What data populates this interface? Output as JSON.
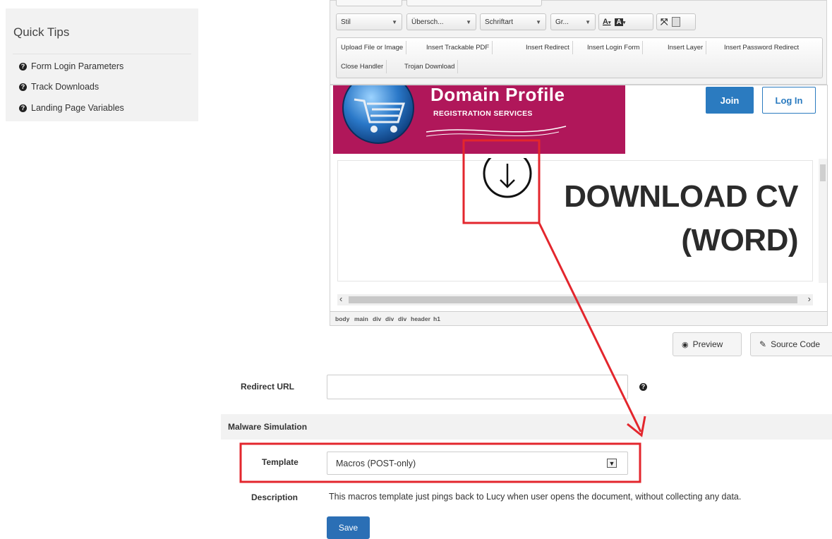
{
  "quick_tips": {
    "title": "Quick Tips",
    "items": [
      "Form Login Parameters",
      "Track Downloads",
      "Landing Page Variables"
    ]
  },
  "editor": {
    "toolbar": {
      "style_combo": "Stil",
      "heading_combo": "Übersch...",
      "font_combo": "Schriftart",
      "size_combo": "Gr...",
      "text_color": "A",
      "bg_color": "A",
      "insert_buttons": [
        "Upload File or Image",
        "Insert Trackable PDF",
        "Insert Redirect",
        "Insert Login Form",
        "Insert Layer",
        "Insert Password Redirect",
        "Close Handler",
        "Trojan Download"
      ]
    },
    "preview": {
      "brand_title": "Domain Profile",
      "brand_subtitle": "REGISTRATION SERVICES",
      "join": "Join",
      "login": "Log In",
      "heading_line1": "DOWNLOAD CV",
      "heading_line2": "(WORD)"
    },
    "element_path": [
      "body",
      "main",
      "div",
      "div",
      "div",
      "header",
      "h1"
    ]
  },
  "actions": {
    "preview": "Preview",
    "source_code": "Source Code"
  },
  "form": {
    "redirect_url_label": "Redirect URL",
    "redirect_url_value": "",
    "section_title": "Malware Simulation",
    "template_label": "Template",
    "template_value": "Macros (POST-only)",
    "description_label": "Description",
    "description_text": "This macros template just pings back to Lucy when user opens the document, without collecting any data.",
    "save": "Save"
  },
  "colors": {
    "annotation_red": "#e3262d",
    "banner_magenta": "#b0175a",
    "primary_blue": "#2b7bc0"
  }
}
